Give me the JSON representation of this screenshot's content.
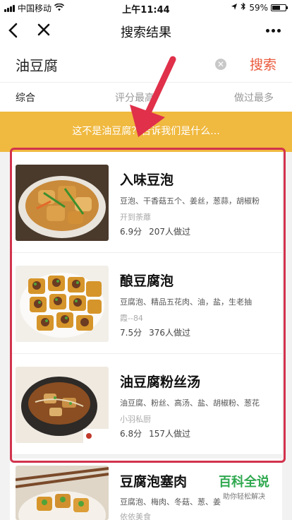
{
  "status_bar": {
    "carrier": "中国移动",
    "time": "上午11:44",
    "battery": "59%",
    "battery_level": 0.59
  },
  "navbar": {
    "title": "搜索结果",
    "back_icon": "chevron-left-icon",
    "close_icon": "close-icon",
    "more_icon": "more-dots-icon"
  },
  "search": {
    "value": "油豆腐",
    "button_label": "搜索"
  },
  "sort_tabs": [
    {
      "label": "综合",
      "active": true
    },
    {
      "label": "评分最高",
      "active": false
    },
    {
      "label": "做过最多",
      "active": false
    }
  ],
  "banner": {
    "text": "这不是油豆腐？告诉我们是什么..."
  },
  "results": [
    {
      "title": "入味豆泡",
      "ingredients": "豆泡、干香菇五个、姜丝，葱蒜，胡椒粉",
      "author": "开到荼蘼",
      "rating": "6.9分",
      "cooked": "207人做过"
    },
    {
      "title": "酿豆腐泡",
      "ingredients": "豆腐泡、精品五花肉、油，盐，生老抽",
      "author": "霞--84",
      "rating": "7.5分",
      "cooked": "376人做过"
    },
    {
      "title": "油豆腐粉丝汤",
      "ingredients": "油豆腐、粉丝、高汤、盐、胡椒粉、葱花",
      "author": "小羽私厨",
      "rating": "6.8分",
      "cooked": "157人做过"
    },
    {
      "title": "豆腐泡塞肉",
      "ingredients": "豆腐泡、梅肉、冬菇、葱、姜",
      "author": "依依美食",
      "rating": "",
      "cooked": ""
    }
  ],
  "watermark": {
    "main": "百科全说",
    "sub": "助你轻松解决"
  },
  "colors": {
    "accent": "#ea5a3d",
    "banner": "#f0b93f",
    "highlight_box": "#d2334d",
    "watermark": "#2fa84f"
  }
}
